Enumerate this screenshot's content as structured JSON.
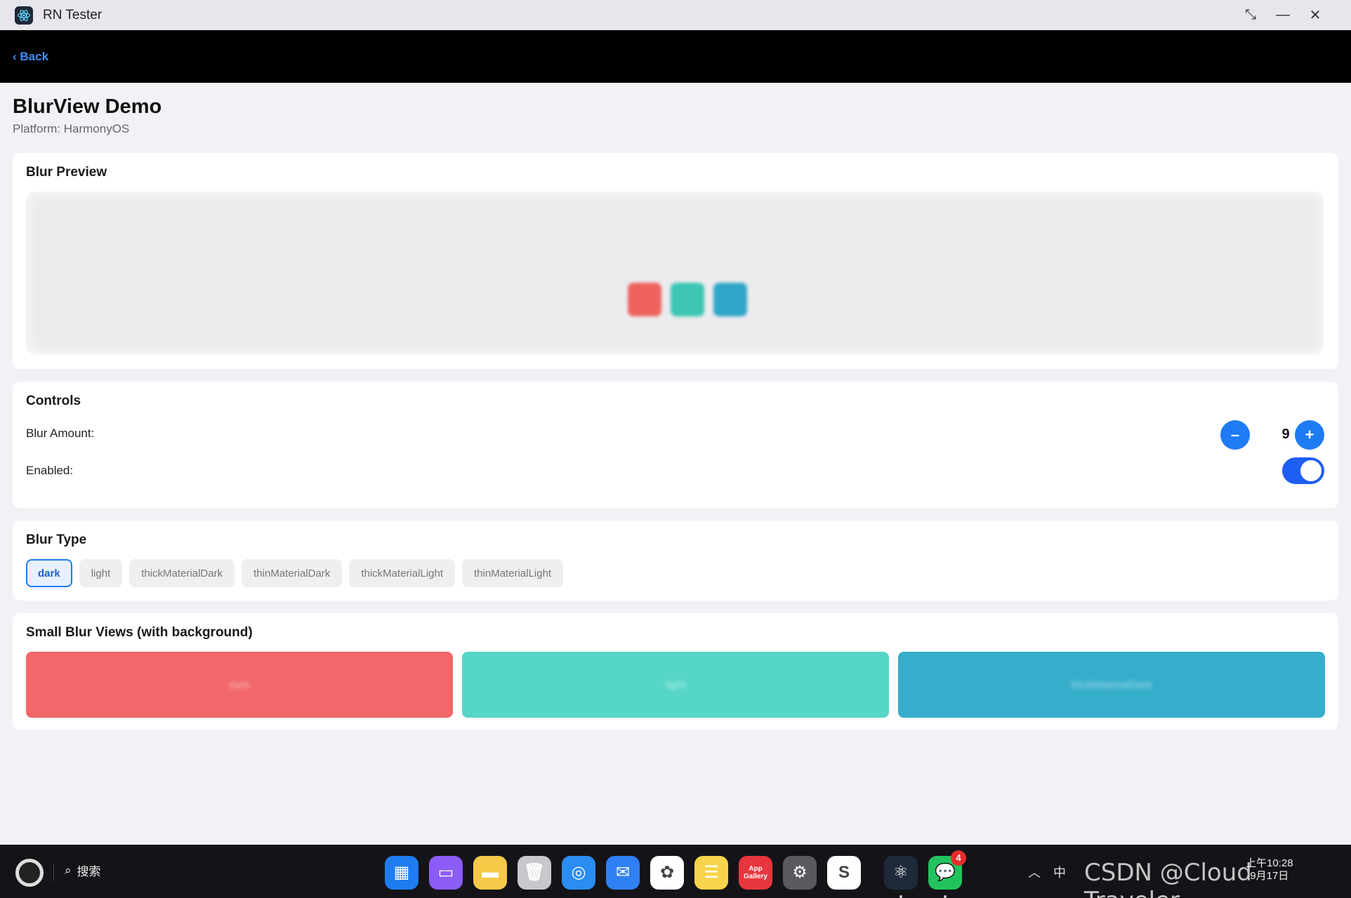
{
  "window": {
    "title": "RN Tester",
    "restore_glyph": "⤡",
    "minimize_glyph": "—",
    "close_glyph": "✕"
  },
  "nav": {
    "back_label": "‹ Back"
  },
  "page": {
    "title": "BlurView Demo",
    "subtitle": "Platform: HarmonyOS"
  },
  "preview": {
    "title": "Blur Preview",
    "squares": [
      "#f0625e",
      "#3dc6b3",
      "#2fa6c8"
    ]
  },
  "controls": {
    "title": "Controls",
    "blur_amount_label": "Blur Amount:",
    "blur_amount_value": "9",
    "decrement_label": "–",
    "increment_label": "+",
    "enabled_label": "Enabled:",
    "enabled": true
  },
  "blur_type": {
    "title": "Blur Type",
    "options": [
      "dark",
      "light",
      "thickMaterialDark",
      "thinMaterialDark",
      "thickMaterialLight",
      "thinMaterialLight"
    ],
    "selected": "dark"
  },
  "small_views": {
    "title": "Small Blur Views (with background)",
    "boxes": [
      {
        "label": "dark",
        "color": "#f2676a"
      },
      {
        "label": "light",
        "color": "#56d6c8"
      },
      {
        "label": "thickMaterialDark",
        "color": "#36aecb"
      }
    ]
  },
  "taskbar": {
    "search_label": "搜索",
    "apps": [
      {
        "name": "app-center",
        "color": "#1f7cf0",
        "glyph": "▦"
      },
      {
        "name": "files",
        "color": "#8b5cf6",
        "glyph": "▭"
      },
      {
        "name": "folder",
        "color": "#f7c948",
        "glyph": "▬"
      },
      {
        "name": "trash",
        "color": "#c8c8cc",
        "glyph": "🗑"
      },
      {
        "name": "browser",
        "color": "#2b8cf2",
        "glyph": "◎"
      },
      {
        "name": "mail",
        "color": "#2f7ff5",
        "glyph": "✉"
      },
      {
        "name": "gallery",
        "color": "#ffffff",
        "glyph": "✿"
      },
      {
        "name": "notes",
        "color": "#f8d44c",
        "glyph": "☰"
      },
      {
        "name": "app-gallery",
        "color": "#e8363f",
        "glyph": "App Gallery"
      },
      {
        "name": "settings",
        "color": "#5a5a5e",
        "glyph": "⚙"
      },
      {
        "name": "codearts",
        "color": "#ffffff",
        "glyph": "S"
      },
      {
        "name": "rn-tester",
        "color": "#1e2a3a",
        "glyph": "⚛"
      },
      {
        "name": "wechat",
        "color": "#22c35e",
        "glyph": "💬",
        "badge": "4"
      }
    ],
    "clock_time": "上午10:28",
    "clock_date": "9月17日",
    "watermark": "CSDN @Cloud Traveler"
  }
}
